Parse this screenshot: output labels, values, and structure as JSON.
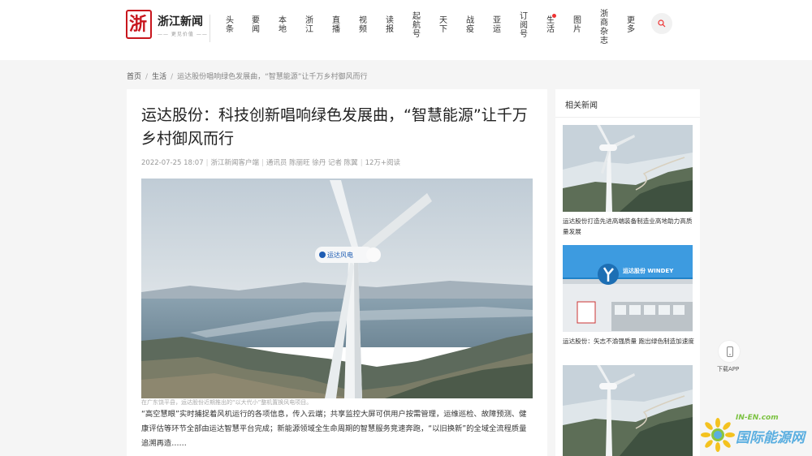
{
  "header": {
    "logo_mark": "浙",
    "logo_name": "浙江新闻",
    "logo_slogan": "—— 更见价值 ——",
    "nav": [
      {
        "label": "头条"
      },
      {
        "label": "要闻"
      },
      {
        "label": "本地"
      },
      {
        "label": "浙江"
      },
      {
        "label": "直播"
      },
      {
        "label": "视频"
      },
      {
        "label": "读报"
      },
      {
        "label": "起航号"
      },
      {
        "label": "天下"
      },
      {
        "label": "战疫"
      },
      {
        "label": "亚运"
      },
      {
        "label": "订阅号"
      },
      {
        "label": "生活"
      },
      {
        "label": "图片"
      },
      {
        "label": "浙商杂志"
      },
      {
        "label": "更多"
      }
    ],
    "search_icon": "search-icon"
  },
  "breadcrumb": {
    "home": "首页",
    "section": "生活",
    "current": "运达股份唱响绿色发展曲，“智慧能源”让千万乡村御风而行"
  },
  "article": {
    "title": "运达股份：科技创新唱响绿色发展曲，“智慧能源”让千万乡村御风而行",
    "date": "2022-07-25 18:07",
    "source": "浙江新闻客户端",
    "authors": "通讯员 陈丽旺 徐丹 记者 陈翼",
    "reads": "12万+阅读",
    "image_caption": "在广东饶平县，运达股份近期推出的“以大代小”整机置换风电项目。",
    "lead": "“高空慧眼”实时捕捉着风机运行的各项信息，传入云端；共享监控大屏可供用户按需管理，运维巡检、故障预测、健康评估等环节全部由运达智慧平台完成；新能源领域全生命周期的智慧服务竞速奔跑，“以旧换新”的全域全流程质量追溯再造……",
    "turbine_brand": "运达风电"
  },
  "sidebar": {
    "title": "相关新闻",
    "items": [
      {
        "text": "运达股份打造先进高端装备制造业高地助力高质量发展"
      },
      {
        "text": "运达股份：矢志不渝强质量 跑出绿色制造加速度",
        "sign": "运达股份 WINDEY"
      },
      {
        "text": ""
      }
    ]
  },
  "float": {
    "app_label": "下载APP",
    "app_icon": "phone-icon"
  },
  "watermark": {
    "top": "IN-EN.com",
    "main": "国际能源网"
  },
  "colors": {
    "brand_red": "#c8161d",
    "badge": "#e33333",
    "sky": "#c9d3da",
    "sea": "#7f98a8"
  }
}
